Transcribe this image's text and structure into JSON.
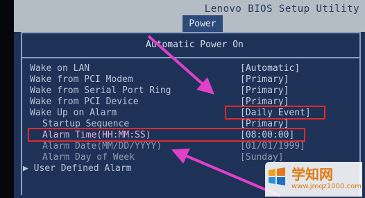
{
  "titlebar": {
    "title": "Lenovo BIOS Setup Utility",
    "tab_power": "Power"
  },
  "panel": {
    "heading": "Automatic Power On"
  },
  "settings": [
    {
      "label": "Wake on LAN",
      "value": "[Automatic]"
    },
    {
      "label": "Wake from PCI Modem",
      "value": "[Primary]"
    },
    {
      "label": "Wake from Serial Port Ring",
      "value": "[Primary]"
    },
    {
      "label": "Wake from PCI Device",
      "value": "[Primary]"
    },
    {
      "label": "Wake Up on Alarm",
      "value": "[Daily Event]"
    },
    {
      "label": "Startup Sequence",
      "value": "[Primary]"
    },
    {
      "label": "Alarm Time(HH:MM:SS)",
      "value": "[08:00:00]"
    },
    {
      "label": "Alarm Date(MM/DD/YYYY)",
      "value": "[01/01/1999]"
    },
    {
      "label": "Alarm Day of Week",
      "value": "[Sunday]"
    },
    {
      "label": "User Defined Alarm",
      "prefix": "▶"
    }
  ],
  "watermark": {
    "brand": "学知网",
    "url": "www.jmqz1000.com"
  },
  "colors": {
    "panel_bg": "#1e3257",
    "titlebar_bg": "#b4bcc4",
    "highlight_box": "#e2282c",
    "arrow": "#e040c8",
    "watermark_text": "#e07a10"
  }
}
